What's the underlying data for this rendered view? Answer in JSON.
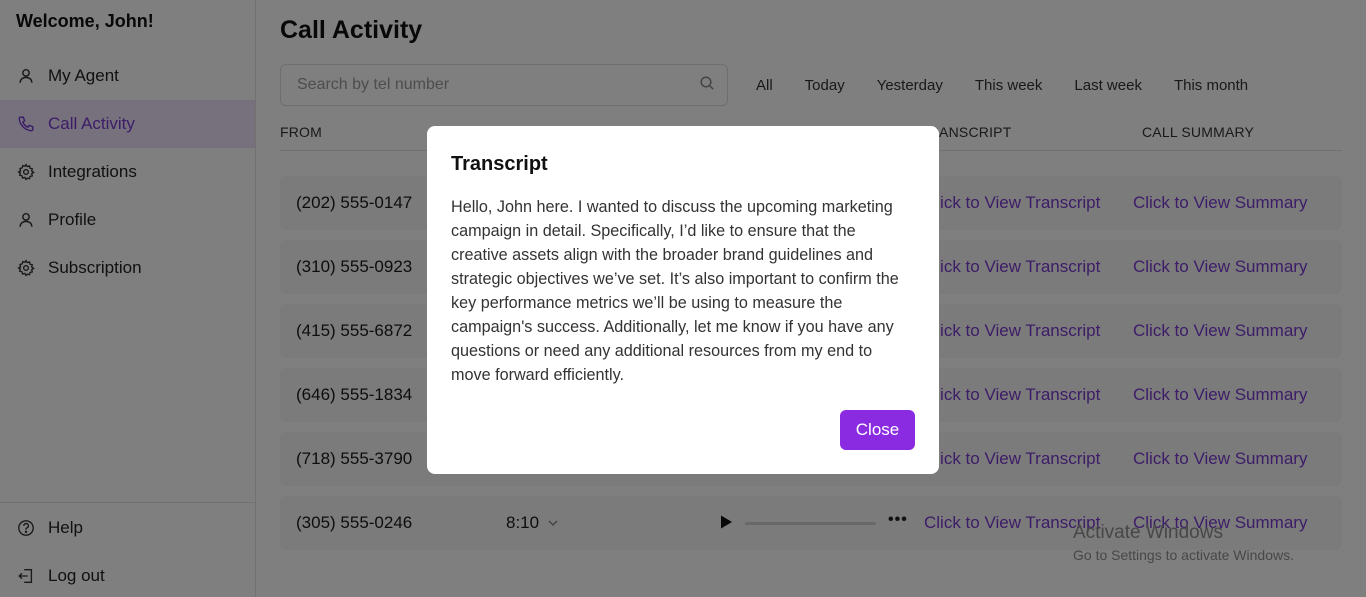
{
  "sidebar": {
    "welcome": "Welcome, John!",
    "items": [
      {
        "label": "My Agent",
        "icon": "user-icon"
      },
      {
        "label": "Call Activity",
        "icon": "phone-icon",
        "active": true
      },
      {
        "label": "Integrations",
        "icon": "gear-icon"
      },
      {
        "label": "Profile",
        "icon": "user-icon"
      },
      {
        "label": "Subscription",
        "icon": "gear-icon"
      }
    ],
    "bottom_items": [
      {
        "label": "Help",
        "icon": "help-icon"
      },
      {
        "label": "Log out",
        "icon": "logout-icon"
      }
    ]
  },
  "main": {
    "title": "Call Activity",
    "search": {
      "placeholder": "Search by tel number",
      "value": ""
    },
    "filters": [
      "All",
      "Today",
      "Yesterday",
      "This week",
      "Last week",
      "This month"
    ],
    "columns": {
      "from": "FROM",
      "transcript": "TRANSCRIPT",
      "summary": "CALL SUMMARY"
    },
    "rows": [
      {
        "tel": "(202) 555-0147"
      },
      {
        "tel": "(310) 555-0923"
      },
      {
        "tel": "(415) 555-6872"
      },
      {
        "tel": "(646) 555-1834"
      },
      {
        "tel": "(718) 555-3790"
      },
      {
        "tel": "(305) 555-0246",
        "duration": "8:10"
      }
    ],
    "transcript_link": "Click to View Transcript",
    "summary_link": "Click to View Summary",
    "more_label": "•••"
  },
  "modal": {
    "title": "Transcript",
    "body": "Hello, John here. I wanted to discuss the upcoming marketing campaign in detail. Specifically, I’d like to ensure that the creative assets align with the broader brand guidelines and strategic objectives we’ve set. It’s also important to confirm the key performance metrics we’ll be using to measure the campaign's success. Additionally, let me know if you have any questions or need any additional resources from my end to move forward efficiently.",
    "close_label": "Close"
  },
  "watermark": {
    "line1": "Activate Windows",
    "line2": "Go to Settings to activate Windows."
  },
  "colors": {
    "accent": "#8a2be2",
    "link": "#7a3ad0",
    "active_bg": "#ece3f8"
  }
}
